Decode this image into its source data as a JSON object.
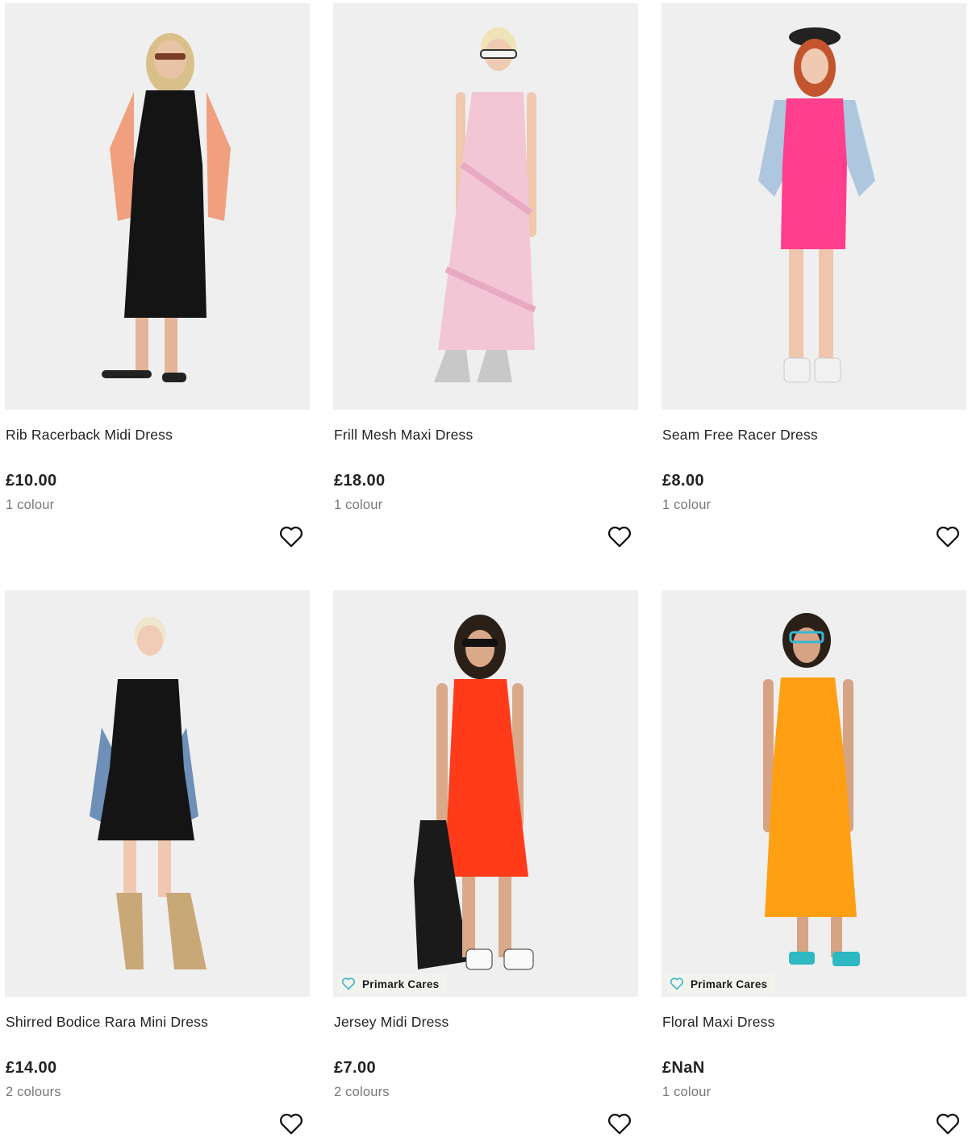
{
  "products": [
    {
      "title": "Rib Racerback Midi Dress",
      "price": "£10.00",
      "colours": "1 colour",
      "badge": "",
      "image_alt": "Model wearing black rib racerback midi dress with peach shirt"
    },
    {
      "title": "Frill Mesh Maxi Dress",
      "price": "£18.00",
      "colours": "1 colour",
      "badge": "",
      "image_alt": "Model wearing pink frill mesh maxi dress with silver boots"
    },
    {
      "title": "Seam Free Racer Dress",
      "price": "£8.00",
      "colours": "1 colour",
      "badge": "",
      "image_alt": "Model wearing pink seam free racer dress with denim jacket"
    },
    {
      "title": "Shirred Bodice Rara Mini Dress",
      "price": "£14.00",
      "colours": "2 colours",
      "badge": "",
      "image_alt": "Model wearing black shirred bodice rara mini dress with cowboy boots"
    },
    {
      "title": "Jersey Midi Dress",
      "price": "£7.00",
      "colours": "2 colours",
      "badge": "Primark Cares",
      "image_alt": "Model wearing red jersey midi dress holding leather jacket"
    },
    {
      "title": "Floral Maxi Dress",
      "price": "£NaN",
      "colours": "1 colour",
      "badge": "Primark Cares",
      "image_alt": "Model wearing orange maxi dress with blue sandals"
    }
  ],
  "icons": {
    "wishlist": "heart-outline-icon",
    "badge": "heart-icon"
  },
  "colors": {
    "badge_heart": "#3cb6c9",
    "image_bg": "#efefef",
    "muted_text": "#777777"
  }
}
